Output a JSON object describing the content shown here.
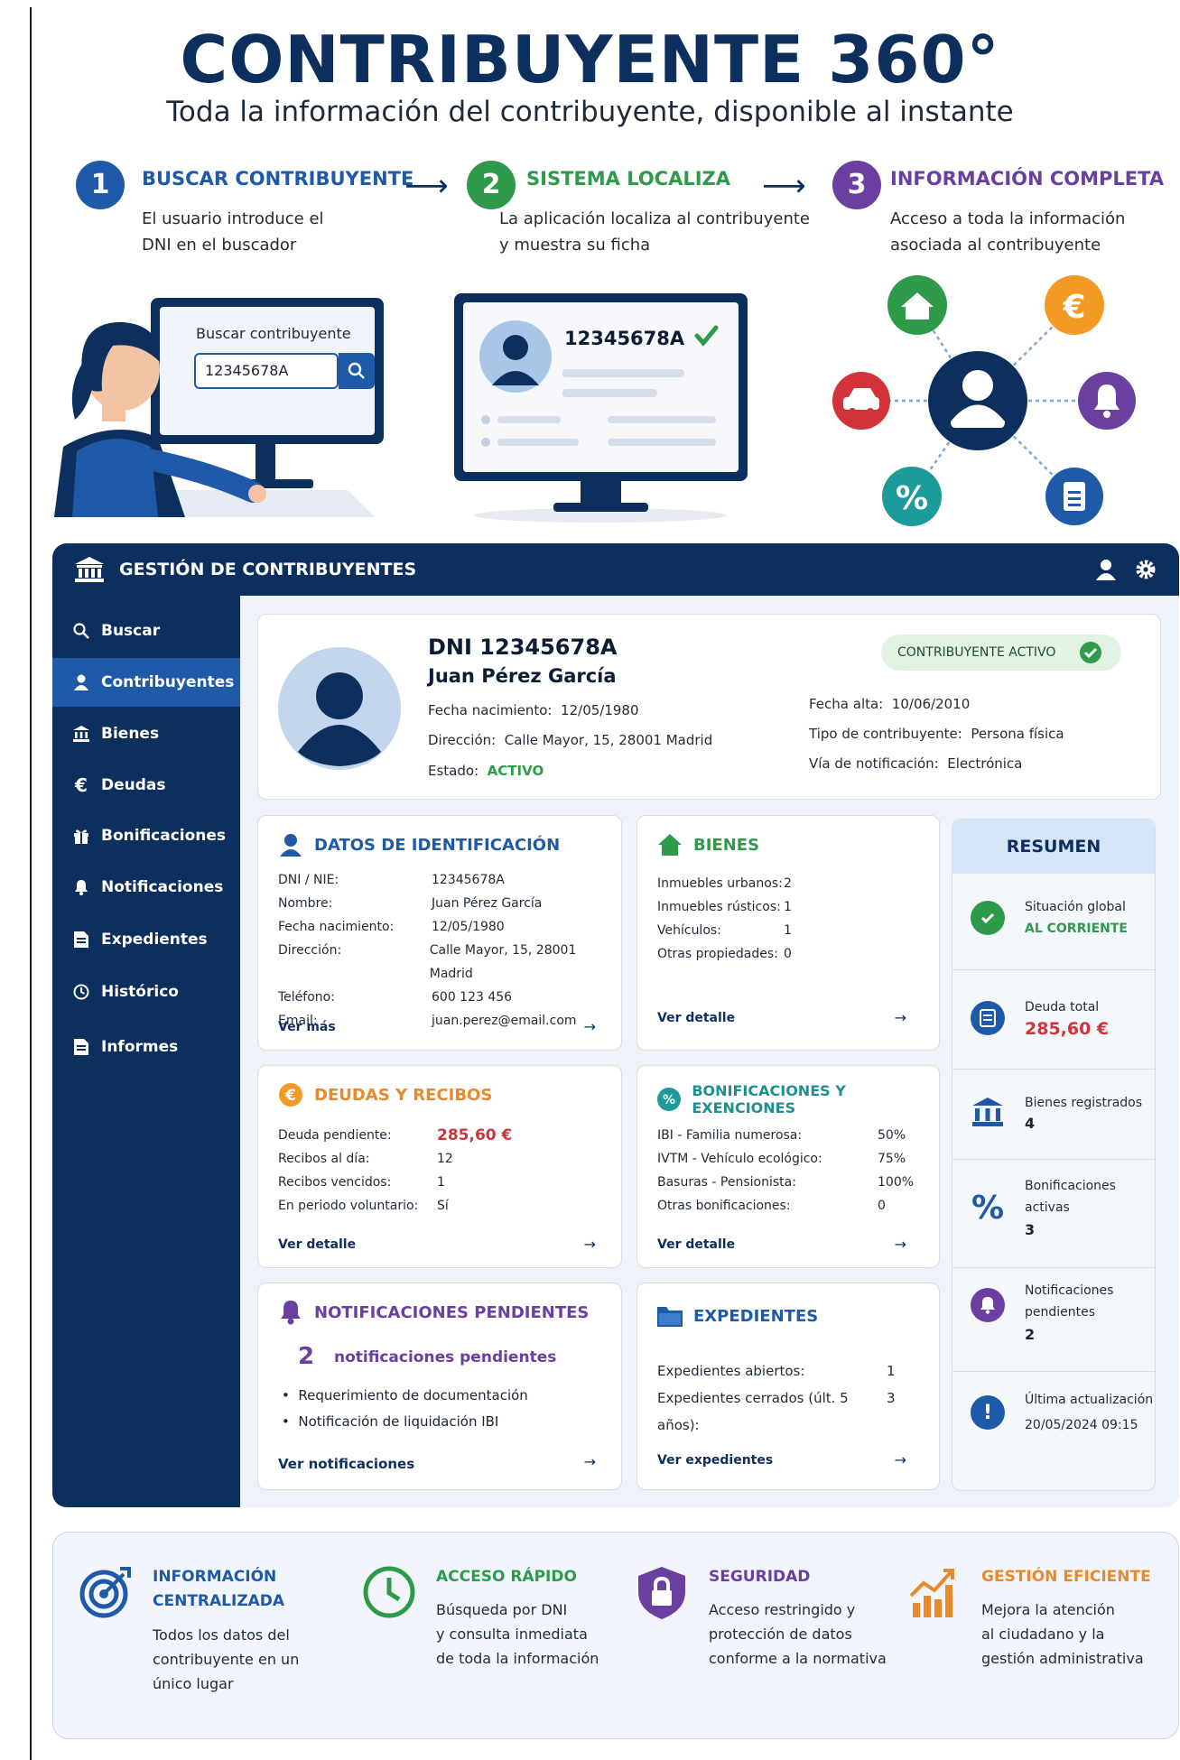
{
  "header": {
    "title": "CONTRIBUYENTE 360°",
    "subtitle": "Toda la información del contribuyente, disponible al instante"
  },
  "steps": [
    {
      "num": "1",
      "title": "BUSCAR CONTRIBUYENTE",
      "line1": "El usuario introduce el",
      "line2": "DNI en el buscador",
      "color": "#1e5aa8"
    },
    {
      "num": "2",
      "title": "SISTEMA LOCALIZA",
      "line1": "La aplicación localiza al contribuyente",
      "line2": "y muestra su ficha",
      "color": "#2f9a4a"
    },
    {
      "num": "3",
      "title": "INFORMACIÓN COMPLETA",
      "line1": "Acceso a toda la información",
      "line2": "asociada al contribuyente",
      "color": "#6b3fa0"
    }
  ],
  "illustration": {
    "search_label": "Buscar contribuyente",
    "search_value": "12345678A",
    "found_dni": "12345678A"
  },
  "app": {
    "title": "GESTIÓN DE CONTRIBUYENTES",
    "sidebar": [
      {
        "label": "Buscar",
        "icon": "search-icon"
      },
      {
        "label": "Contribuyentes",
        "icon": "user-icon",
        "active": true
      },
      {
        "label": "Bienes",
        "icon": "bank-icon"
      },
      {
        "label": "Deudas",
        "icon": "euro-icon"
      },
      {
        "label": "Bonificaciones",
        "icon": "gift-icon"
      },
      {
        "label": "Notificaciones",
        "icon": "bell-icon"
      },
      {
        "label": "Expedientes",
        "icon": "document-icon"
      },
      {
        "label": "Histórico",
        "icon": "history-icon"
      },
      {
        "label": "Informes",
        "icon": "report-icon"
      }
    ]
  },
  "profile": {
    "dni": "DNI 12345678A",
    "name": "Juan Pérez García",
    "birth_label": "Fecha nacimiento:",
    "birth": "12/05/1980",
    "address_label": "Dirección:",
    "address": "Calle Mayor, 15, 28001 Madrid",
    "status_label": "Estado:",
    "status": "ACTIVO",
    "badge": "CONTRIBUYENTE ACTIVO",
    "alta_label": "Fecha alta:",
    "alta": "10/06/2010",
    "tipo_label": "Tipo de contribuyente:",
    "tipo": "Persona física",
    "via_label": "Vía de notificación:",
    "via": "Electrónica"
  },
  "identificacion": {
    "title": "DATOS DE IDENTIFICACIÓN",
    "rows": [
      {
        "k": "DNI / NIE:",
        "v": "12345678A"
      },
      {
        "k": "Nombre:",
        "v": "Juan Pérez García"
      },
      {
        "k": "Fecha nacimiento:",
        "v": "12/05/1980"
      },
      {
        "k": "Dirección:",
        "v": "Calle Mayor, 15, 28001 Madrid"
      },
      {
        "k": "Teléfono:",
        "v": "600 123 456"
      },
      {
        "k": "Email:",
        "v": "juan.perez@email.com"
      }
    ],
    "link": "Ver más"
  },
  "bienes": {
    "title": "BIENES",
    "rows": [
      {
        "k": "Inmuebles urbanos:",
        "v": "2"
      },
      {
        "k": "Inmuebles rústicos:",
        "v": "1"
      },
      {
        "k": "Vehículos:",
        "v": "1"
      },
      {
        "k": "Otras propiedades:",
        "v": "0"
      }
    ],
    "link": "Ver detalle"
  },
  "deudas": {
    "title": "DEUDAS Y RECIBOS",
    "rows": [
      {
        "k": "Deuda pendiente:",
        "v": "285,60 €"
      },
      {
        "k": "Recibos al día:",
        "v": "12"
      },
      {
        "k": "Recibos vencidos:",
        "v": "1"
      },
      {
        "k": "En periodo voluntario:",
        "v": "Sí"
      }
    ],
    "link": "Ver detalle"
  },
  "bonificaciones": {
    "title": "BONIFICACIONES Y EXENCIONES",
    "rows": [
      {
        "k": "IBI - Familia numerosa:",
        "v": "50%"
      },
      {
        "k": "IVTM - Vehículo ecológico:",
        "v": "75%"
      },
      {
        "k": "Basuras - Pensionista:",
        "v": "100%"
      },
      {
        "k": "Otras bonificaciones:",
        "v": "0"
      }
    ],
    "link": "Ver detalle"
  },
  "notificaciones": {
    "title": "NOTIFICACIONES PENDIENTES",
    "count": "2",
    "count_label": "notificaciones pendientes",
    "items": [
      "Requerimiento de documentación",
      "Notificación de liquidación IBI"
    ],
    "link": "Ver notificaciones"
  },
  "expedientes": {
    "title": "EXPEDIENTES",
    "rows": [
      {
        "k": "Expedientes abiertos:",
        "v": "1"
      },
      {
        "k": "Expedientes cerrados (últ. 5 años):",
        "v": "3"
      }
    ],
    "link": "Ver expedientes"
  },
  "resumen": {
    "title": "RESUMEN",
    "situacion_label": "Situación global",
    "situacion": "AL CORRIENTE",
    "deuda_label": "Deuda total",
    "deuda": "285,60 €",
    "bienes_label": "Bienes registrados",
    "bienes": "4",
    "bonif_label1": "Bonificaciones",
    "bonif_label2": "activas",
    "bonif": "3",
    "notif_label1": "Notificaciones",
    "notif_label2": "pendientes",
    "notif": "2",
    "update_label": "Última actualización",
    "update": "20/05/2024 09:15"
  },
  "features": [
    {
      "title1": "INFORMACIÓN",
      "title2": "CENTRALIZADA",
      "d": [
        "Todos los datos del",
        "contribuyente en un",
        "único lugar"
      ],
      "color": "#1e5aa8"
    },
    {
      "title1": "ACCESO RÁPIDO",
      "d": [
        "Búsqueda por DNI",
        "y consulta inmediata",
        "de toda la información"
      ],
      "color": "#2f9a4a"
    },
    {
      "title1": "SEGURIDAD",
      "d": [
        "Acceso restringido y",
        "protección de datos",
        "conforme a la normativa"
      ],
      "color": "#6b3fa0"
    },
    {
      "title1": "GESTIÓN EFICIENTE",
      "d": [
        "Mejora la atención",
        "al ciudadano y la",
        "gestión administrativa"
      ],
      "color": "#e8892b"
    }
  ],
  "colors": {
    "navy": "#0d2f5e",
    "blue": "#1e5aa8",
    "green": "#2f9a4a",
    "purple": "#6b3fa0",
    "orange": "#e8892b",
    "red": "#d2333a"
  }
}
